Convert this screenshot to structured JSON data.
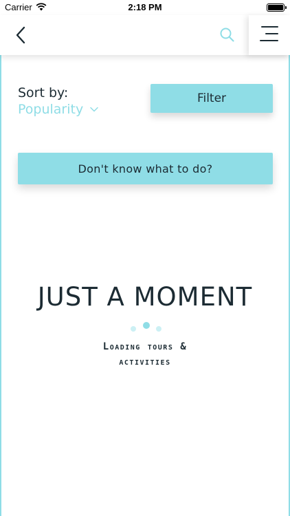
{
  "status_bar": {
    "carrier": "Carrier",
    "time": "2:18 PM"
  },
  "nav": {
    "back_icon": "chevron-left-icon",
    "search_icon": "search-icon",
    "menu_icon": "hamburger-menu-icon"
  },
  "sort": {
    "label": "Sort by:",
    "value": "Popularity"
  },
  "filter_label": "Filter",
  "help_label": "Don't know what to do?",
  "loading": {
    "title": "JUST A MOMENT",
    "subtitle_line1": "Loading tours &",
    "subtitle_line2": "activities"
  },
  "colors": {
    "accent": "#8fdde6",
    "text": "#1c2b33",
    "background": "#ffffff"
  }
}
